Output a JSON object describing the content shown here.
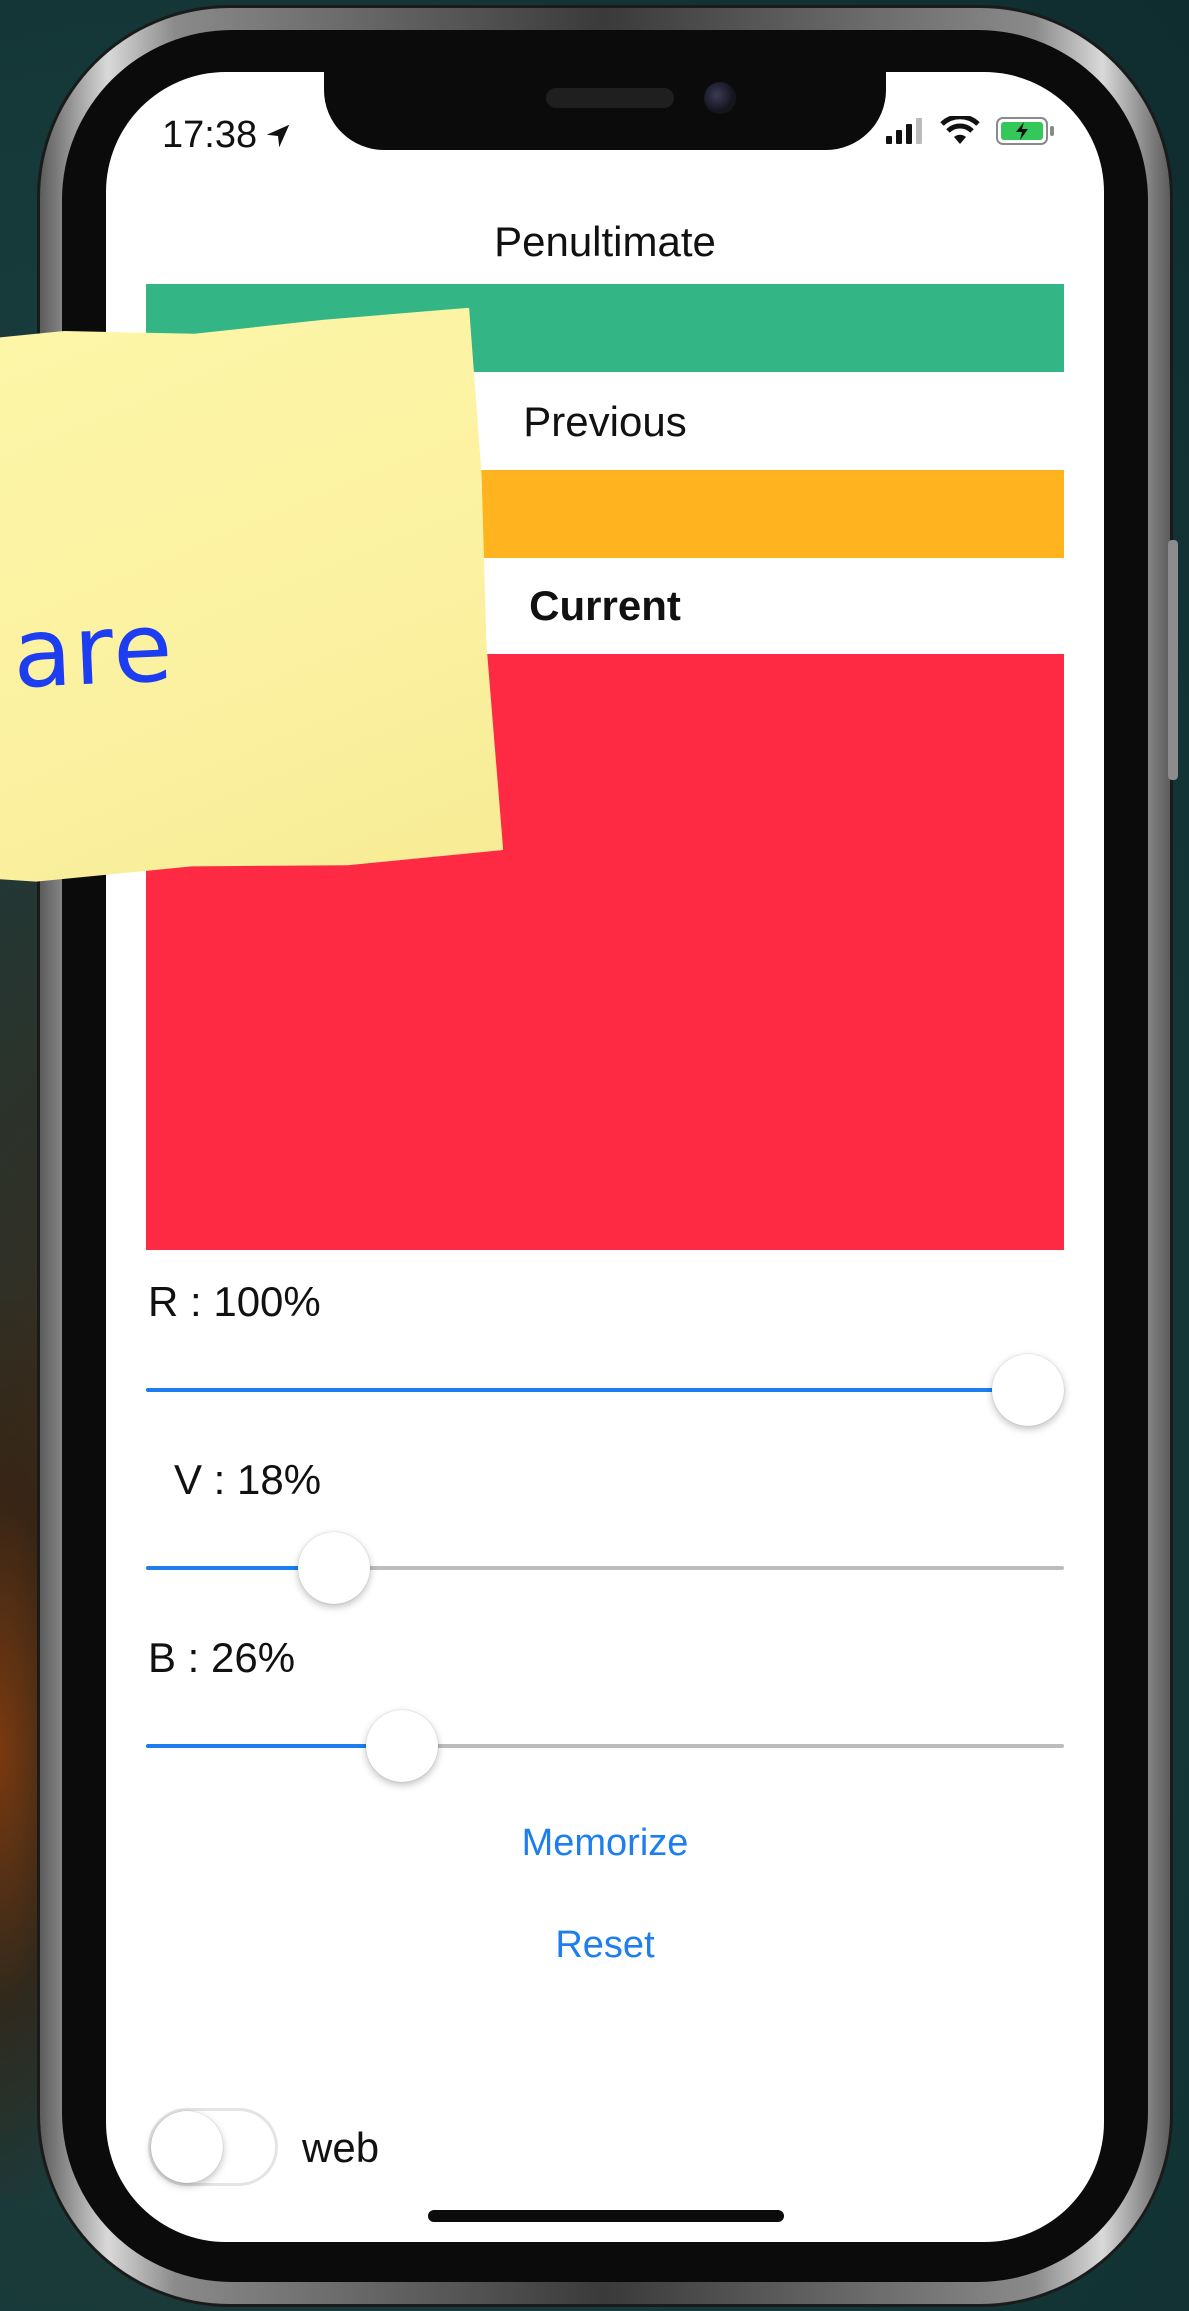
{
  "status_bar": {
    "time": "17:38",
    "location_icon": "location-arrow-icon",
    "signal_icon": "cellular-signal-icon",
    "wifi_icon": "wifi-icon",
    "battery_icon": "battery-charging-icon"
  },
  "swatches": {
    "penultimate": {
      "label": "Penultimate",
      "color": "#34b585"
    },
    "previous": {
      "label": "Previous",
      "color": "#ffb31f"
    },
    "current": {
      "label": "Current",
      "color": "#fe2a43"
    }
  },
  "sliders": [
    {
      "label": "R : 100%",
      "value": 1.0
    },
    {
      "label": "V : 18%",
      "value": 0.18
    },
    {
      "label": "B : 26%",
      "value": 0.26
    }
  ],
  "actions": {
    "memorize_label": "Memorize",
    "reset_label": "Reset"
  },
  "web_toggle": {
    "label": "web",
    "on": false
  },
  "sticky_note": {
    "text": "are"
  },
  "colors": {
    "accent": "#1e7ef0"
  }
}
